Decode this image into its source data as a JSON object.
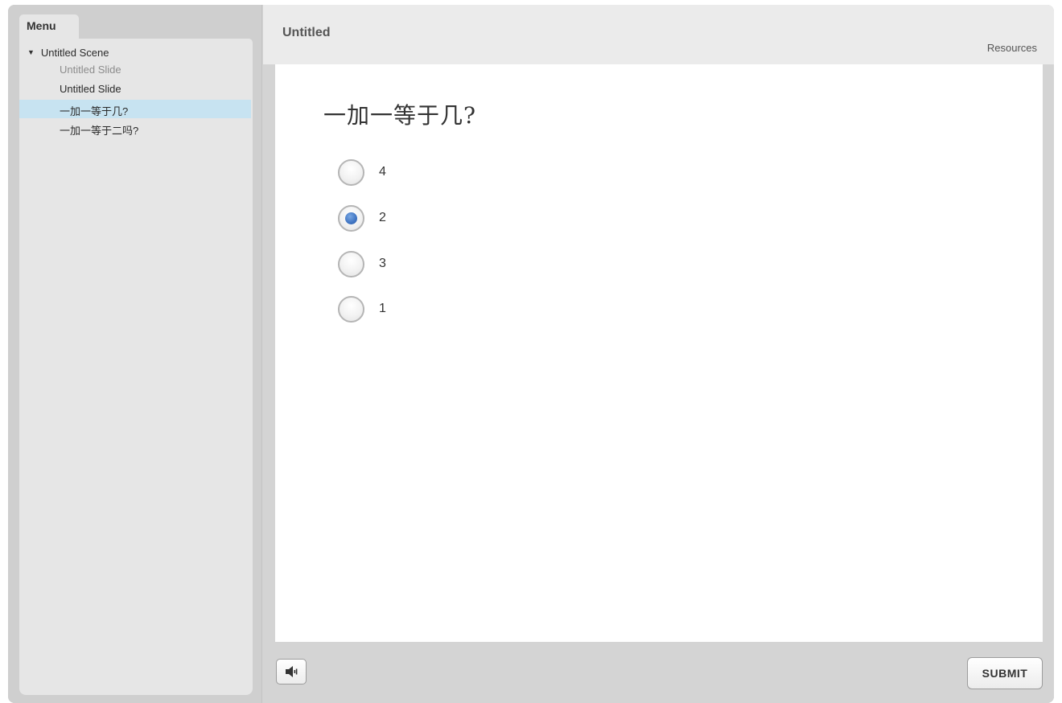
{
  "sidebar": {
    "tab_label": "Menu",
    "scene": {
      "label": "Untitled Scene",
      "icon": "caret-down-icon"
    },
    "items": [
      {
        "label": "Untitled Slide",
        "state": "visited"
      },
      {
        "label": "Untitled Slide",
        "state": "normal"
      },
      {
        "label": "一加一等于几?",
        "state": "selected"
      },
      {
        "label": "一加一等于二吗?",
        "state": "normal"
      }
    ]
  },
  "header": {
    "title": "Untitled",
    "resources_label": "Resources"
  },
  "slide": {
    "question": "一加一等于几?",
    "choices": [
      {
        "label": "4",
        "selected": false
      },
      {
        "label": "2",
        "selected": true
      },
      {
        "label": "3",
        "selected": false
      },
      {
        "label": "1",
        "selected": false
      }
    ]
  },
  "footer": {
    "audio_icon": "speaker-icon",
    "submit_label": "SUBMIT"
  },
  "colors": {
    "selected_row": "#c7e3f1",
    "radio_fill": "#3f74c2",
    "frame": "#d4d4d4"
  }
}
